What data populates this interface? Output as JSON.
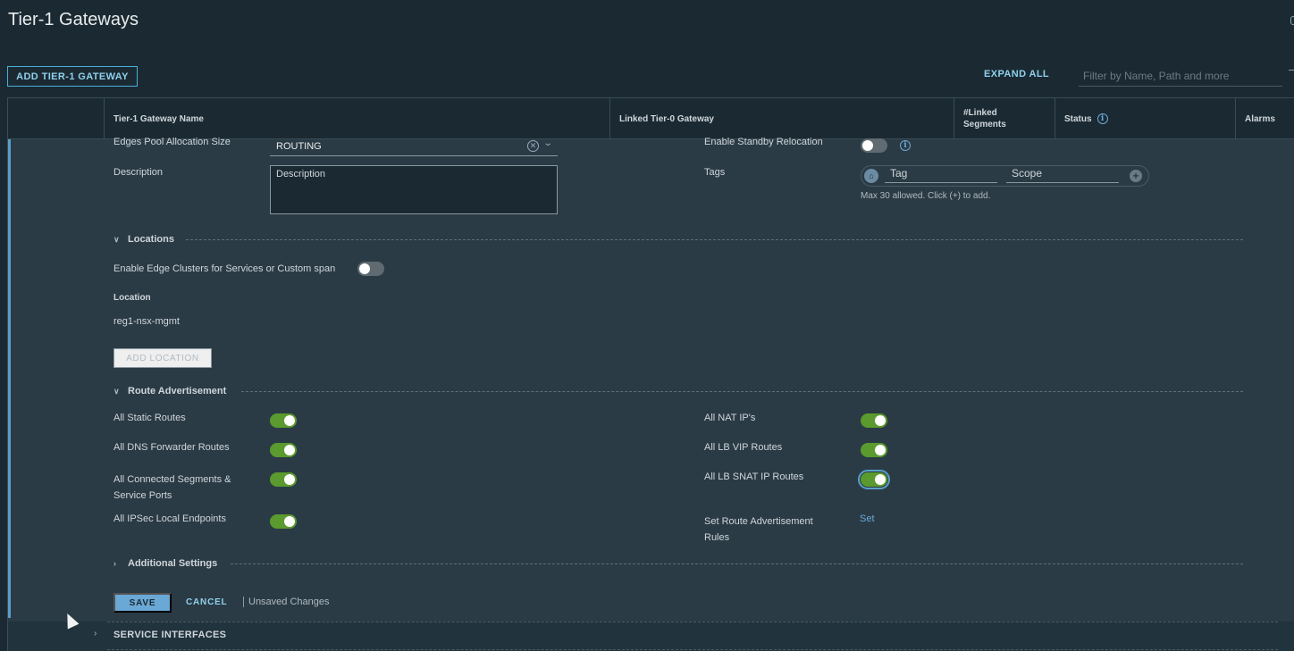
{
  "page": {
    "title": "Tier-1 Gateways"
  },
  "toolbar": {
    "add_label": "ADD TIER-1 GATEWAY",
    "expand_all": "EXPAND ALL",
    "filter_placeholder": "Filter by Name, Path and more"
  },
  "table": {
    "columns": [
      {
        "label": ""
      },
      {
        "label": "Tier-1 Gateway Name"
      },
      {
        "label": "Linked Tier-0 Gateway"
      },
      {
        "label": "#Linked Segments"
      },
      {
        "label": "Status"
      },
      {
        "label": "Alarms"
      }
    ]
  },
  "form": {
    "edges_pool_label": "Edges Pool Allocation Size",
    "edges_pool_value": "ROUTING",
    "description_label": "Description",
    "description_placeholder": "Description",
    "standby_label": "Enable Standby Relocation",
    "standby_on": false,
    "tags_label": "Tags",
    "tag_placeholder": "Tag",
    "scope_placeholder": "Scope",
    "tags_hint": "Max 30 allowed. Click (+) to add."
  },
  "locations": {
    "title": "Locations",
    "edge_clusters_label": "Enable Edge Clusters for Services or Custom span",
    "edge_clusters_on": false,
    "location_header": "Location",
    "location_value": "reg1-nsx-mgmt",
    "add_location": "ADD LOCATION"
  },
  "route_adv": {
    "title": "Route Advertisement",
    "left": [
      {
        "label": "All Static Routes",
        "on": true
      },
      {
        "label": "All DNS Forwarder Routes",
        "on": true
      },
      {
        "label": "All Connected Segments & Service Ports",
        "on": true
      },
      {
        "label": "All IPSec Local Endpoints",
        "on": true
      }
    ],
    "right": [
      {
        "label": "All NAT IP's",
        "on": true
      },
      {
        "label": "All LB VIP Routes",
        "on": true
      },
      {
        "label": "All LB SNAT IP Routes",
        "on": true
      }
    ],
    "rules_label": "Set Route Advertisement Rules",
    "rules_link": "Set"
  },
  "additional": {
    "title": "Additional Settings"
  },
  "actions": {
    "save": "SAVE",
    "cancel": "CANCEL",
    "unsaved": "Unsaved Changes"
  },
  "service_interfaces": {
    "title": "SERVICE INTERFACES"
  },
  "colors": {
    "accent": "#49afd9",
    "toggle_on": "#5a9a2e",
    "primary_button": "#6aa8d6"
  }
}
